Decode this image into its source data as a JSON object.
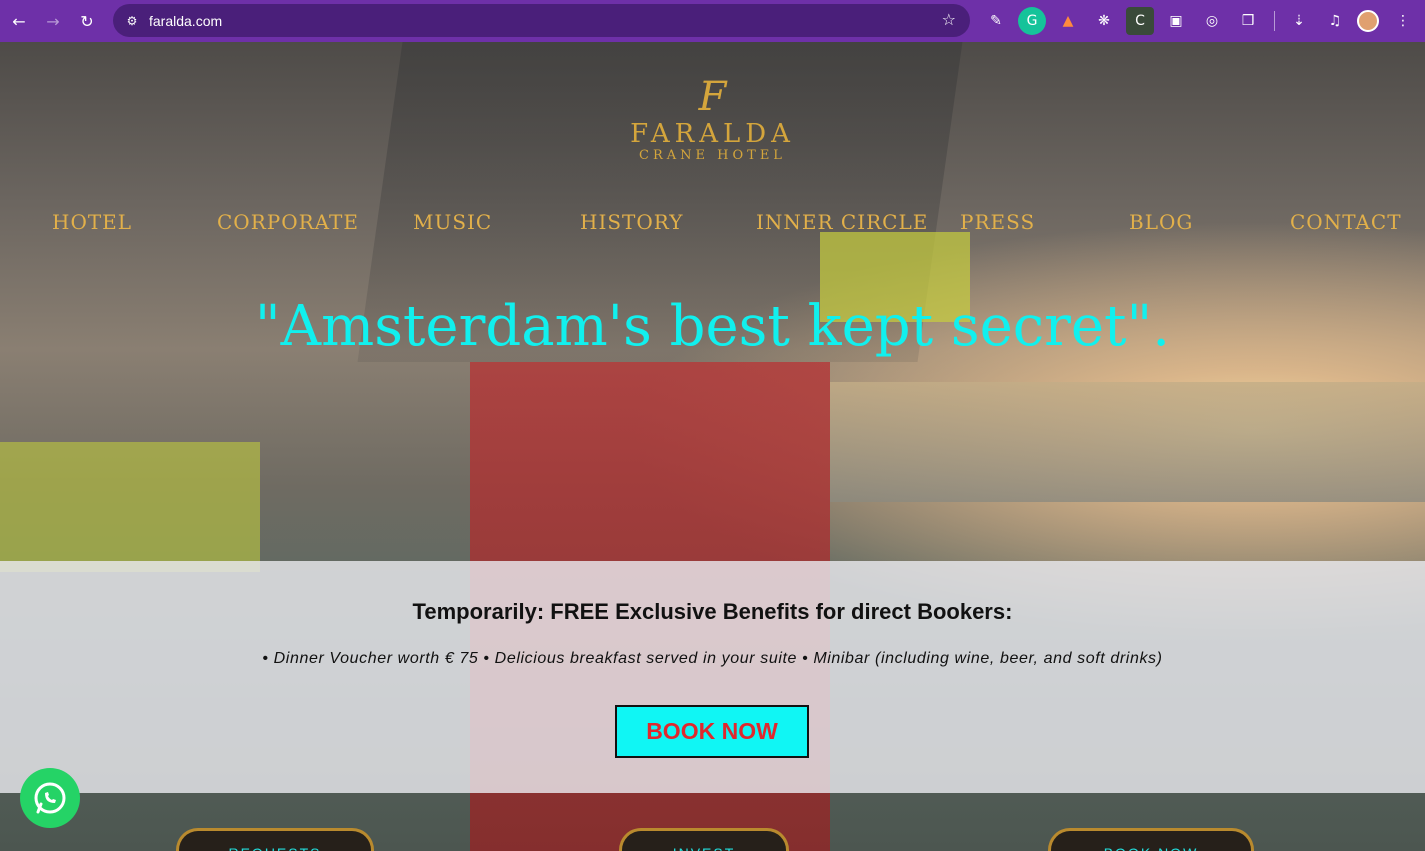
{
  "browser": {
    "url": "faralda.com",
    "back_icon": "back-arrow-icon",
    "forward_icon": "forward-arrow-icon",
    "reload_icon": "reload-icon",
    "extensions": [
      "eyedropper-icon",
      "grammarly-icon",
      "extension-flame-icon",
      "react-icon",
      "extension-c-icon",
      "screen-record-icon",
      "extension-target-icon",
      "puzzle-icon",
      "download-icon",
      "media-queue-icon"
    ]
  },
  "logo": {
    "mark": "F",
    "name": "FARALDA",
    "subtitle": "CRANE HOTEL"
  },
  "nav": {
    "items": [
      "HOTEL",
      "CORPORATE",
      "MUSIC",
      "HISTORY",
      "INNER CIRCLE",
      "PRESS",
      "BLOG",
      "CONTACT"
    ]
  },
  "hero": {
    "tagline": "\"Amsterdam's best kept secret\"."
  },
  "promo": {
    "title": "Temporarily: FREE Exclusive Benefits for direct Bookers:",
    "benefits": "• Dinner Voucher worth € 75 • Delicious breakfast served in your suite • Minibar (including wine, beer, and soft drinks)",
    "button": "BOOK NOW"
  },
  "bottom_buttons": [
    "REQUESTS",
    "INVEST",
    "BOOK NOW"
  ],
  "colors": {
    "accent_cyan": "#10f6f4",
    "gold": "#d4a53c",
    "book_text": "#e0282d",
    "chrome": "#6e30a8"
  }
}
